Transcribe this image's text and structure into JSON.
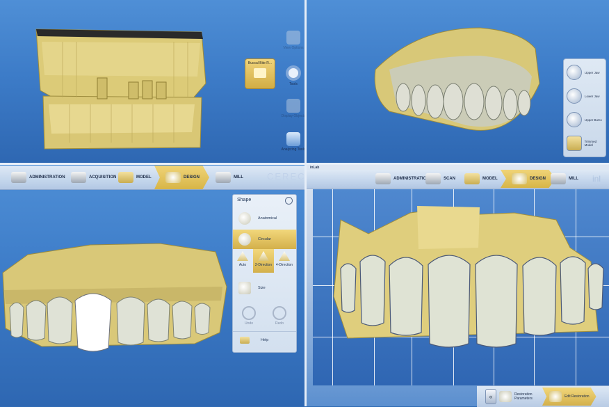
{
  "top_left": {
    "toolbar": {
      "buccal_bite": "Buccal Bite R...",
      "view_options": "View Options",
      "tools": "Tools",
      "display_objects": "Display Objects",
      "analyzing_tools": "Analyzing Tools"
    }
  },
  "top_right": {
    "models_panel": [
      {
        "label": "Upper Jaw",
        "icon": "upper-jaw-icon"
      },
      {
        "label": "Lower Jaw",
        "icon": "lower-jaw-icon"
      },
      {
        "label": "Upper BuCo",
        "icon": "upper-buccal-icon"
      },
      {
        "label": "Trimmed Model",
        "icon": "trimmed-model-icon"
      }
    ]
  },
  "bottom_left": {
    "nav": [
      {
        "label": "ADMINISTRATION",
        "icon": "administration-icon"
      },
      {
        "label": "ACQUISITION",
        "icon": "acquisition-icon"
      },
      {
        "label": "MODEL",
        "icon": "model-icon"
      },
      {
        "label": "DESIGN",
        "icon": "design-icon",
        "active": true
      },
      {
        "label": "MILL",
        "icon": "mill-icon"
      }
    ],
    "brand": "CEREC",
    "shape_panel": {
      "title": "Shape",
      "anatomical": "Anatomical",
      "circular": "Circular",
      "directions": [
        "Auto",
        "2-Direction",
        "4-Direction"
      ],
      "size": "Size",
      "undo": "Undo",
      "redo": "Redo",
      "help": "Help"
    }
  },
  "bottom_right": {
    "logo": "inLab",
    "nav": [
      {
        "label": "ADMINISTRATION",
        "icon": "administration-icon"
      },
      {
        "label": "SCAN",
        "icon": "scan-icon"
      },
      {
        "label": "MODEL",
        "icon": "model-icon"
      },
      {
        "label": "DESIGN",
        "icon": "design-icon",
        "active": true
      },
      {
        "label": "MILL",
        "icon": "mill-icon"
      }
    ],
    "brand": "inl",
    "bottom_bar": {
      "restoration_parameters": "Restoration Parameters",
      "edit_restoration": "Edit Restoration"
    }
  },
  "colors": {
    "background_blue": "#3d7cc8",
    "model_gold": "#e1cf7c",
    "tooth_white": "#e8e8de",
    "active_gold": "#d7b547"
  }
}
